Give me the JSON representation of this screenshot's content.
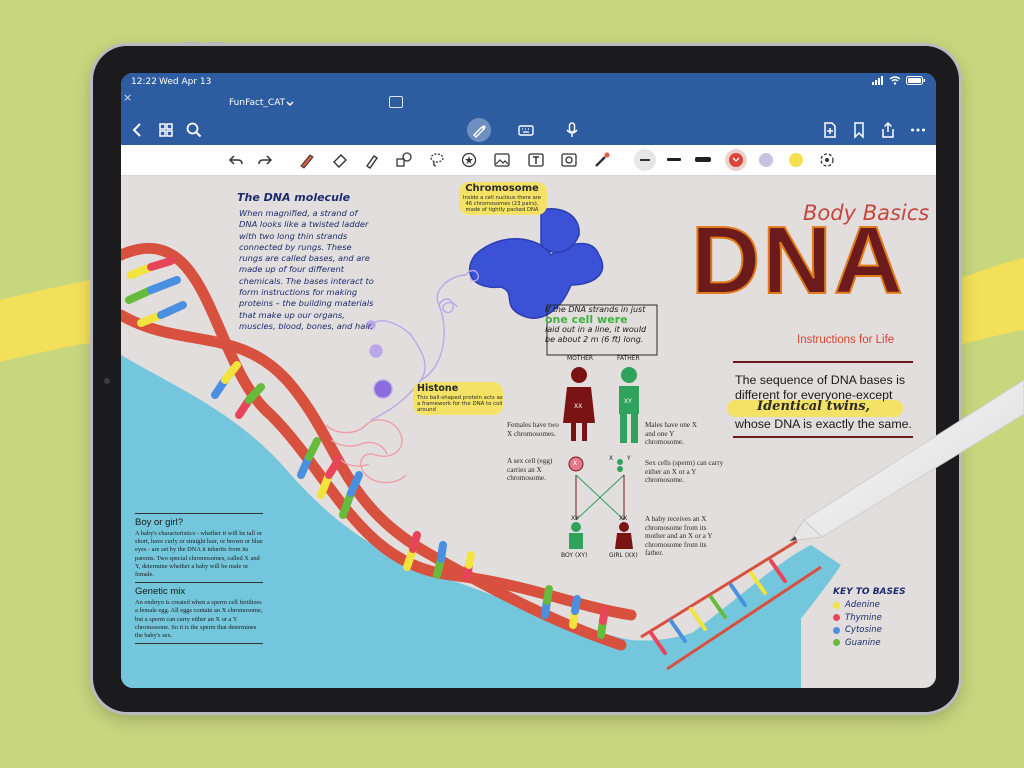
{
  "status_bar": {
    "time": "12:22",
    "date": "Wed Apr 13"
  },
  "tab": {
    "title": "FunFact_CAT",
    "close": "×"
  },
  "navbar": {
    "left_icons": [
      "back-icon",
      "grid-icon",
      "search-icon"
    ],
    "center_icons": [
      "pen-mode-icon",
      "keyboard-icon",
      "microphone-icon"
    ],
    "right_icons": [
      "add-page-icon",
      "bookmark-icon",
      "share-icon",
      "more-icon"
    ]
  },
  "toolbar": {
    "tools": [
      "undo-icon",
      "redo-icon",
      "pen-icon",
      "eraser-icon",
      "highlighter-icon",
      "shapes-icon",
      "lasso-icon",
      "sticker-icon",
      "image-icon",
      "text-icon",
      "camera-icon",
      "laser-icon"
    ],
    "colors": {
      "selected": "#d9473b",
      "lilac": "#c6c3df",
      "yellow": "#f5e052"
    }
  },
  "notes": {
    "dna_molecule_title": "The DNA molecule",
    "dna_molecule_body": "When magnified, a strand of DNA looks like a twisted ladder with two long thin strands connected by rungs. These rungs are called bases, and are made up of four different chemicals. The bases interact to form instructions for making proteins – the building materials that make up our organs, muscles, blood, bones, and hair.",
    "chromosome_title": "Chromosome",
    "chromosome_body": "Inside a cell nucleus there are 46 chromosomes (23 pairs), made of tightly packed DNA",
    "histone_title": "Histone",
    "histone_body": "This ball-shaped protein acts as a framework for the DNA to coil around",
    "cell_line1": "If the DNA strands in just",
    "cell_line2": "one cell were",
    "cell_line3": "laid out in a line, it would be about 2 m (6 ft) long.",
    "body_basics": "Body Basics",
    "dna_big": "DNA",
    "instructions": "Instructions for Life",
    "sequence_pre": "The sequence of DNA bases is different for everyone-except",
    "identical": "Identical twins,",
    "sequence_post": "whose DNA is exactly the same.",
    "mother": "MOTHER",
    "father": "FATHER",
    "mother_xx": "XX",
    "father_xy": "XY",
    "females": "Females have two X chromosomes.",
    "males": "Males have one X and one Y chromosome.",
    "egg": "A sex cell (egg) carries an X chromosome.",
    "sperm": "Sex cells (sperm) can carry either an X or a Y chromosome.",
    "baby": "A baby receives an X chromosome from its mother and an X or a Y chromosome from its father.",
    "boy": "BOY (XY)",
    "girl": "GIRL (XX)",
    "boy_xy": "XY",
    "girl_xx": "XX",
    "egg_x": "X",
    "sperm_x": "X",
    "sperm_y": "Y",
    "boy_or_girl_title": "Boy or girl?",
    "boy_or_girl_body": "A baby's characteristics - whether it will be tall or short, have curly or straight hair, or brown or blue eyes - are set by the DNA it inherits from its parents. Two special chromosomes, called X and Y, determine whether a baby will be male or female.",
    "genetic_mix_title": "Genetic mix",
    "genetic_mix_body": "An embryo is created when a sperm cell fertilizes a female egg. All eggs contain an X chromosome, but a sperm can carry either an X or a Y chromosome. So it is the sperm that determines the baby's sex.",
    "key_title": "KEY TO BASES",
    "key_items": [
      {
        "label": "Adenine",
        "color": "#f2e43c"
      },
      {
        "label": "Thymine",
        "color": "#e8455a"
      },
      {
        "label": "Cytosine",
        "color": "#4a8fe0"
      },
      {
        "label": "Guanine",
        "color": "#66bb3d"
      }
    ]
  }
}
